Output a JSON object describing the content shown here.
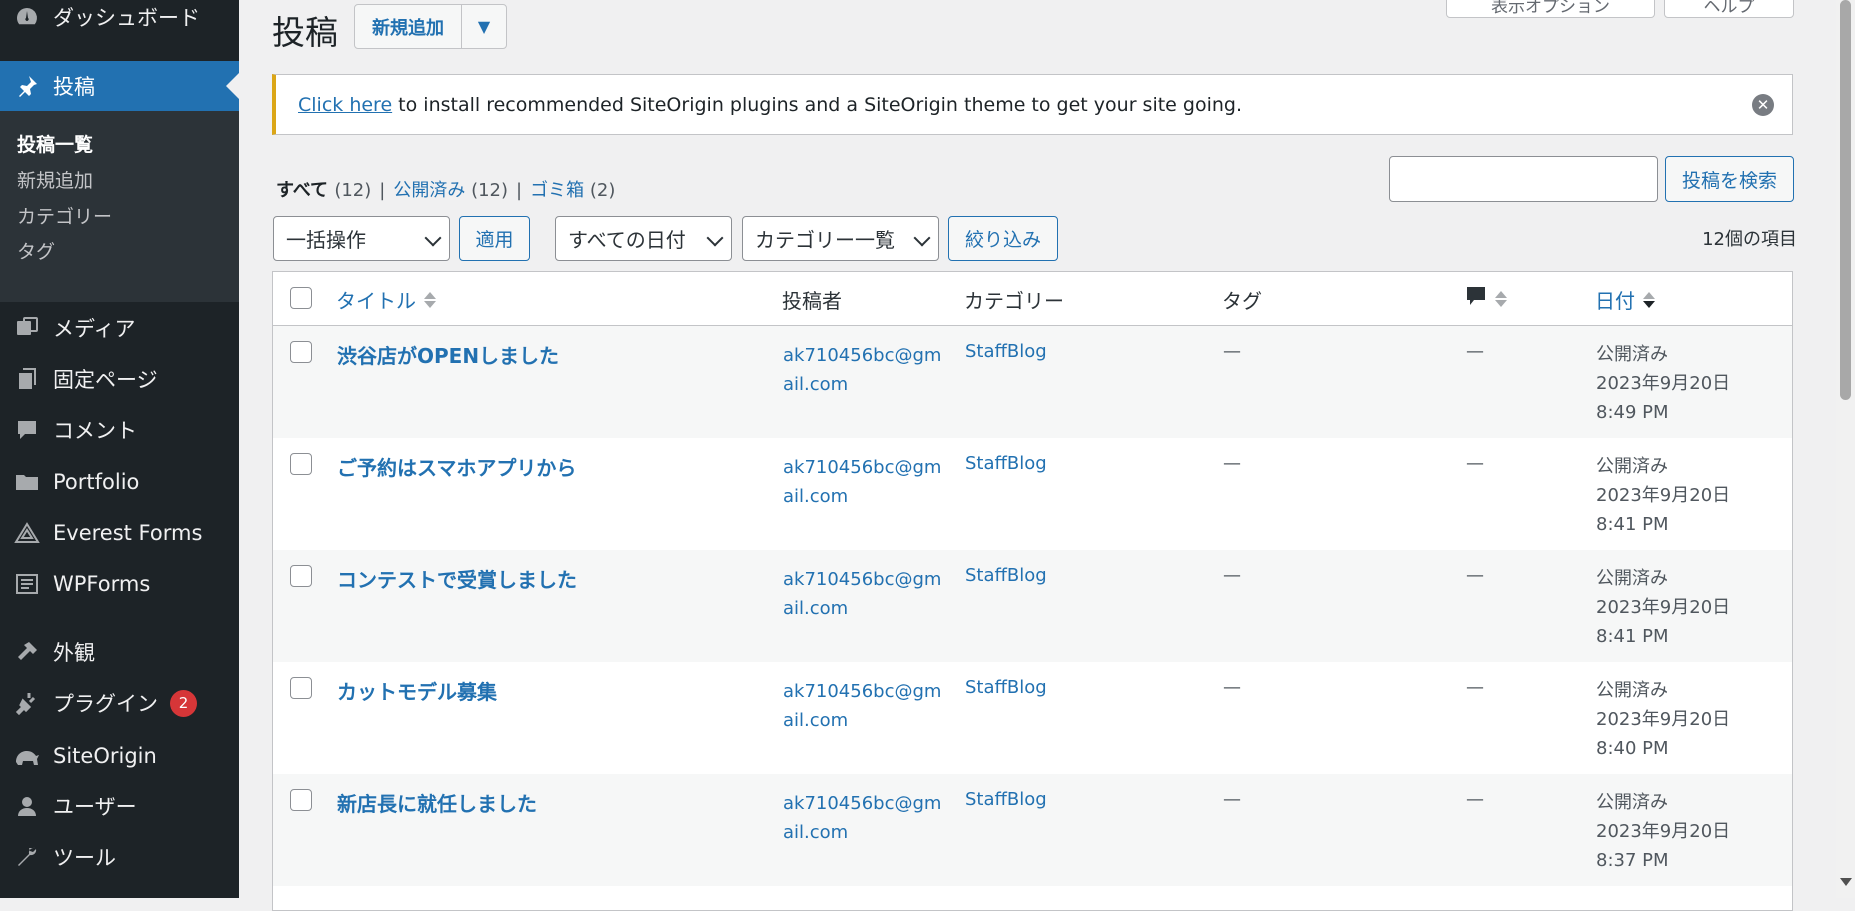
{
  "sidebar": {
    "items": [
      {
        "label": "ダッシュボード",
        "icon": "dashboard-icon"
      },
      {
        "label": "投稿",
        "icon": "pin-icon"
      },
      {
        "label": "メディア",
        "icon": "media-icon"
      },
      {
        "label": "固定ページ",
        "icon": "pages-icon"
      },
      {
        "label": "コメント",
        "icon": "comment-icon"
      },
      {
        "label": "Portfolio",
        "icon": "folder-icon"
      },
      {
        "label": "Everest Forms",
        "icon": "everest-forms-icon"
      },
      {
        "label": "WPForms",
        "icon": "wpforms-icon"
      },
      {
        "label": "外観",
        "icon": "appearance-icon"
      },
      {
        "label": "プラグイン",
        "icon": "plugin-icon",
        "badge": "2"
      },
      {
        "label": "SiteOrigin",
        "icon": "siteorigin-icon"
      },
      {
        "label": "ユーザー",
        "icon": "user-icon"
      },
      {
        "label": "ツール",
        "icon": "wrench-icon"
      }
    ],
    "submenu": [
      "投稿一覧",
      "新規追加",
      "カテゴリー",
      "タグ"
    ]
  },
  "header": {
    "title": "投稿",
    "add_new": "新規追加",
    "dropdown_arrow": "▼",
    "screen_options": "表示オプション",
    "help": "ヘルプ"
  },
  "notice": {
    "link": "Click here",
    "text": " to install recommended SiteOrigin plugins and a SiteOrigin theme to get your site going.",
    "dismiss": "✕"
  },
  "filters": {
    "all": "すべて",
    "all_count": "(12)",
    "published": "公開済み",
    "published_count": "(12)",
    "trash": "ゴミ箱",
    "trash_count": "(2)",
    "separator": "|"
  },
  "search": {
    "button": "投稿を検索"
  },
  "tablenav": {
    "bulk": "一括操作",
    "apply": "適用",
    "dates": "すべての日付",
    "categories": "カテゴリー一覧",
    "filter": "絞り込み",
    "count": "12個の項目"
  },
  "table": {
    "headers": {
      "title": "タイトル",
      "author": "投稿者",
      "category": "カテゴリー",
      "tags": "タグ",
      "date": "日付"
    },
    "rows": [
      {
        "title": "渋谷店がOPENしました",
        "author": "ak710456bc@gmail.com",
        "category": "StaffBlog",
        "tags": "—",
        "comments": "—",
        "status": "公開済み",
        "date": "2023年9月20日 8:49 PM"
      },
      {
        "title": "ご予約はスマホアプリから",
        "author": "ak710456bc@gmail.com",
        "category": "StaffBlog",
        "tags": "—",
        "comments": "—",
        "status": "公開済み",
        "date": "2023年9月20日 8:41 PM"
      },
      {
        "title": "コンテストで受賞しました",
        "author": "ak710456bc@gmail.com",
        "category": "StaffBlog",
        "tags": "—",
        "comments": "—",
        "status": "公開済み",
        "date": "2023年9月20日 8:41 PM"
      },
      {
        "title": "カットモデル募集",
        "author": "ak710456bc@gmail.com",
        "category": "StaffBlog",
        "tags": "—",
        "comments": "—",
        "status": "公開済み",
        "date": "2023年9月20日 8:40 PM"
      },
      {
        "title": "新店長に就任しました",
        "author": "ak710456bc@gmail.com",
        "category": "StaffBlog",
        "tags": "—",
        "comments": "—",
        "status": "公開済み",
        "date": "2023年9月20日 8:37 PM"
      }
    ]
  },
  "colors": {
    "sidebar_bg": "#1d2327",
    "accent": "#2271b1",
    "notice_border": "#dba617",
    "badge": "#d63638"
  }
}
